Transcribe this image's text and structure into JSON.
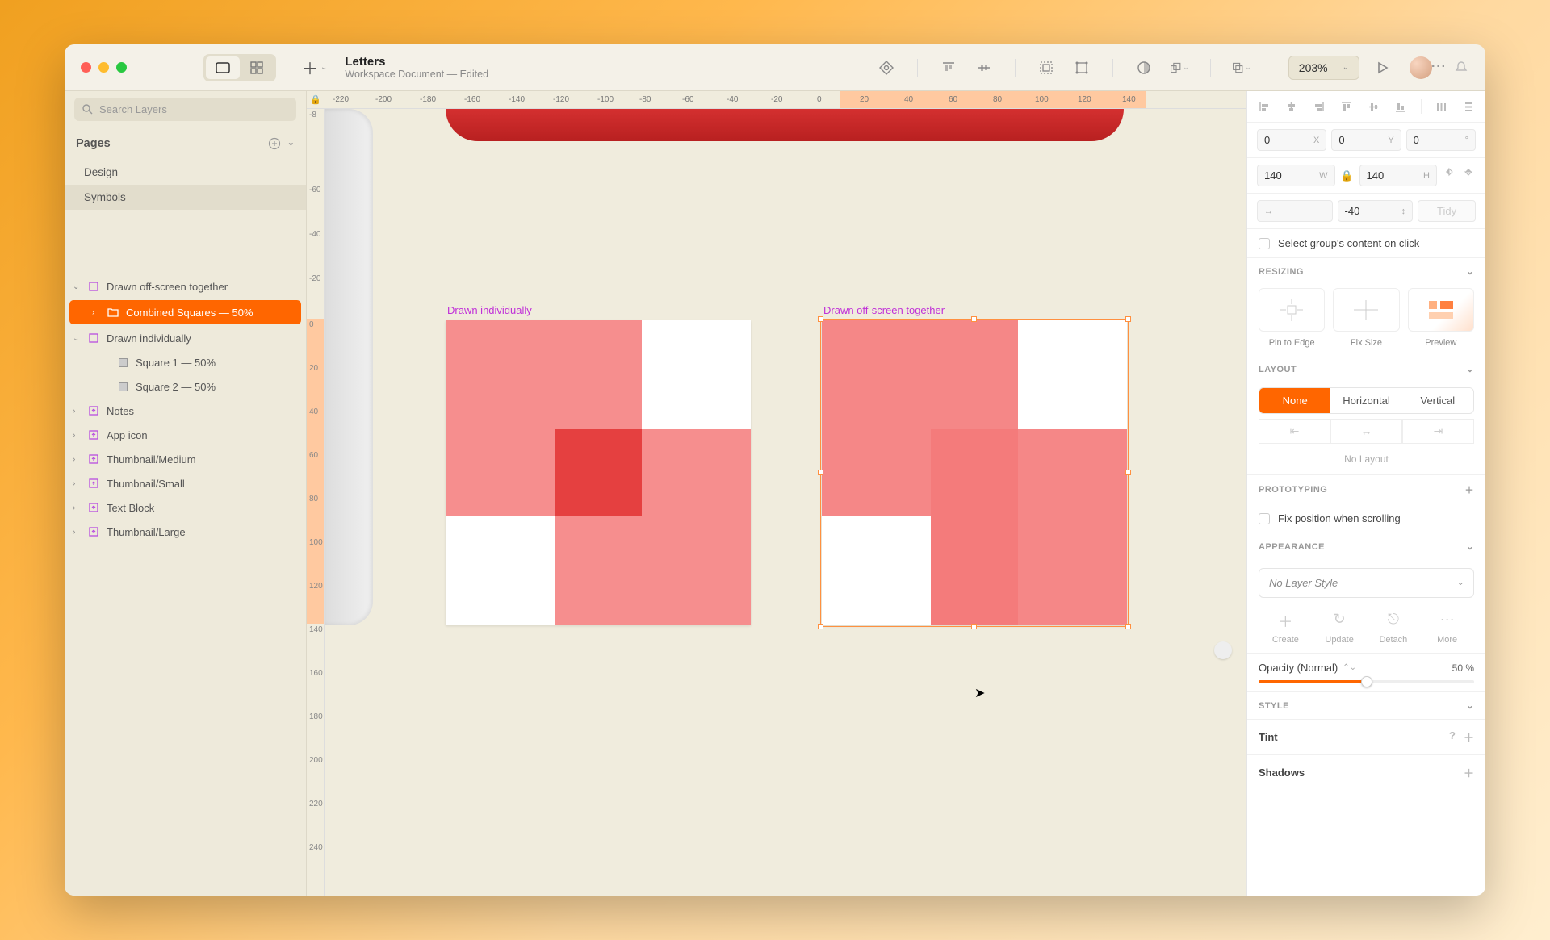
{
  "document": {
    "title": "Letters",
    "subtitle": "Workspace Document — Edited"
  },
  "zoom": "203%",
  "search_placeholder": "Search Layers",
  "pages": {
    "header": "Pages",
    "items": [
      "Design",
      "Symbols"
    ],
    "selected": 1
  },
  "layers": [
    {
      "type": "artboard",
      "label": "Drawn off-screen together",
      "indent": 0,
      "open": true
    },
    {
      "type": "group",
      "label": "Combined Squares — 50%",
      "indent": 1,
      "selected": true
    },
    {
      "type": "artboard",
      "label": "Drawn individually",
      "indent": 0,
      "open": true
    },
    {
      "type": "shape",
      "label": "Square 1 — 50%",
      "indent": 2
    },
    {
      "type": "shape",
      "label": "Square 2 — 50%",
      "indent": 2
    },
    {
      "type": "symbol",
      "label": "Notes",
      "indent": 0
    },
    {
      "type": "symbol",
      "label": "App icon",
      "indent": 0
    },
    {
      "type": "symbol",
      "label": "Thumbnail/Medium",
      "indent": 0
    },
    {
      "type": "symbol",
      "label": "Thumbnail/Small",
      "indent": 0
    },
    {
      "type": "symbol",
      "label": "Text Block",
      "indent": 0
    },
    {
      "type": "symbol",
      "label": "Thumbnail/Large",
      "indent": 0
    }
  ],
  "ruler_h": [
    "-220",
    "-200",
    "-180",
    "-160",
    "-140",
    "-120",
    "-100",
    "-80",
    "-60",
    "-40",
    "-20",
    "0",
    "20",
    "40",
    "60",
    "80",
    "100",
    "120",
    "140"
  ],
  "ruler_v": [
    "-8",
    "-60",
    "-40",
    "-20",
    "0",
    "20",
    "40",
    "60",
    "80",
    "100",
    "120",
    "140",
    "160",
    "180",
    "200",
    "220",
    "240"
  ],
  "canvas": {
    "artboard1_label": "Drawn individually",
    "artboard2_label": "Drawn off-screen together"
  },
  "inspector": {
    "x": "0",
    "x_label": "X",
    "y": "0",
    "y_label": "Y",
    "rot": "0",
    "rot_label": "°",
    "w": "140",
    "w_label": "W",
    "h": "140",
    "h_label": "H",
    "gap": "-40",
    "tidy": "Tidy",
    "select_group": "Select group's content on click",
    "resizing_header": "RESIZING",
    "resize_labels": [
      "Pin to Edge",
      "Fix Size",
      "Preview"
    ],
    "layout_header": "LAYOUT",
    "layout_options": [
      "None",
      "Horizontal",
      "Vertical"
    ],
    "no_layout": "No Layout",
    "prototyping_header": "PROTOTYPING",
    "fix_scroll": "Fix position when scrolling",
    "appearance_header": "APPEARANCE",
    "layer_style": "No Layer Style",
    "style_actions": [
      "Create",
      "Update",
      "Detach",
      "More"
    ],
    "opacity_label": "Opacity (Normal)",
    "opacity_value": "50 %",
    "opacity_pct": 50,
    "style_header": "STYLE",
    "tint": "Tint",
    "shadows": "Shadows"
  }
}
